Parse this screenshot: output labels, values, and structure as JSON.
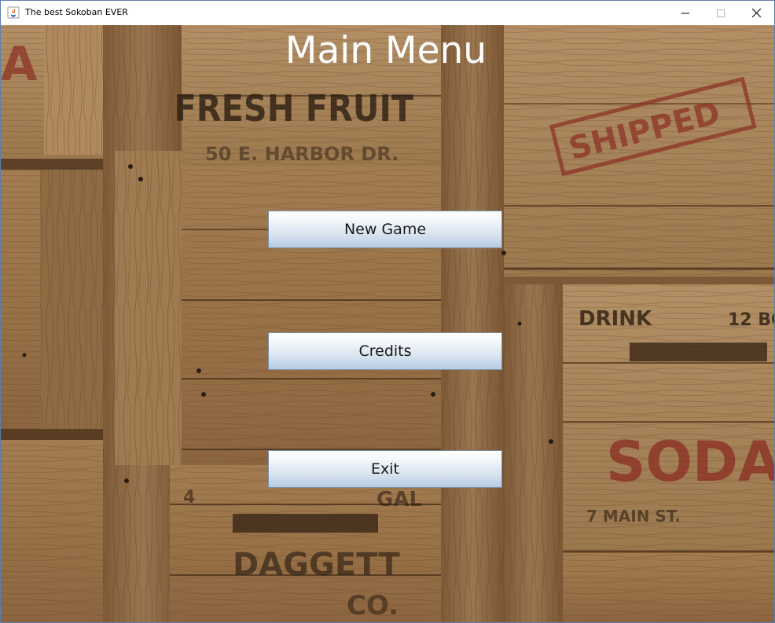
{
  "window": {
    "title": "The best Sokoban EVER",
    "app_icon": "java-icon",
    "controls": [
      "minimize-icon",
      "maximize-icon",
      "close-icon"
    ]
  },
  "background": {
    "description_icon": "wooden-crates-background",
    "stencils": {
      "crate_left_top": "A",
      "fresh_fruit": "FRESH FRUIT",
      "harbor": "50 E. HARBOR DR.",
      "shipped": "SHIPPED",
      "drink": "DRINK",
      "twelve_bo": "12 BO",
      "soda": "SODA",
      "main_st": "7 MAIN ST.",
      "gal": "GAL",
      "four": "4",
      "daggett": "DAGGETT",
      "co": "CO."
    }
  },
  "menu": {
    "title": "Main Menu",
    "buttons": {
      "new_game": "New Game",
      "credits": "Credits",
      "exit": "Exit"
    }
  },
  "colors": {
    "wood_base": "#8a6540",
    "button_top": "#ffffff",
    "button_bottom": "#b7cbe0",
    "button_border": "#7a8fa6",
    "title_text": "#ffffff"
  }
}
